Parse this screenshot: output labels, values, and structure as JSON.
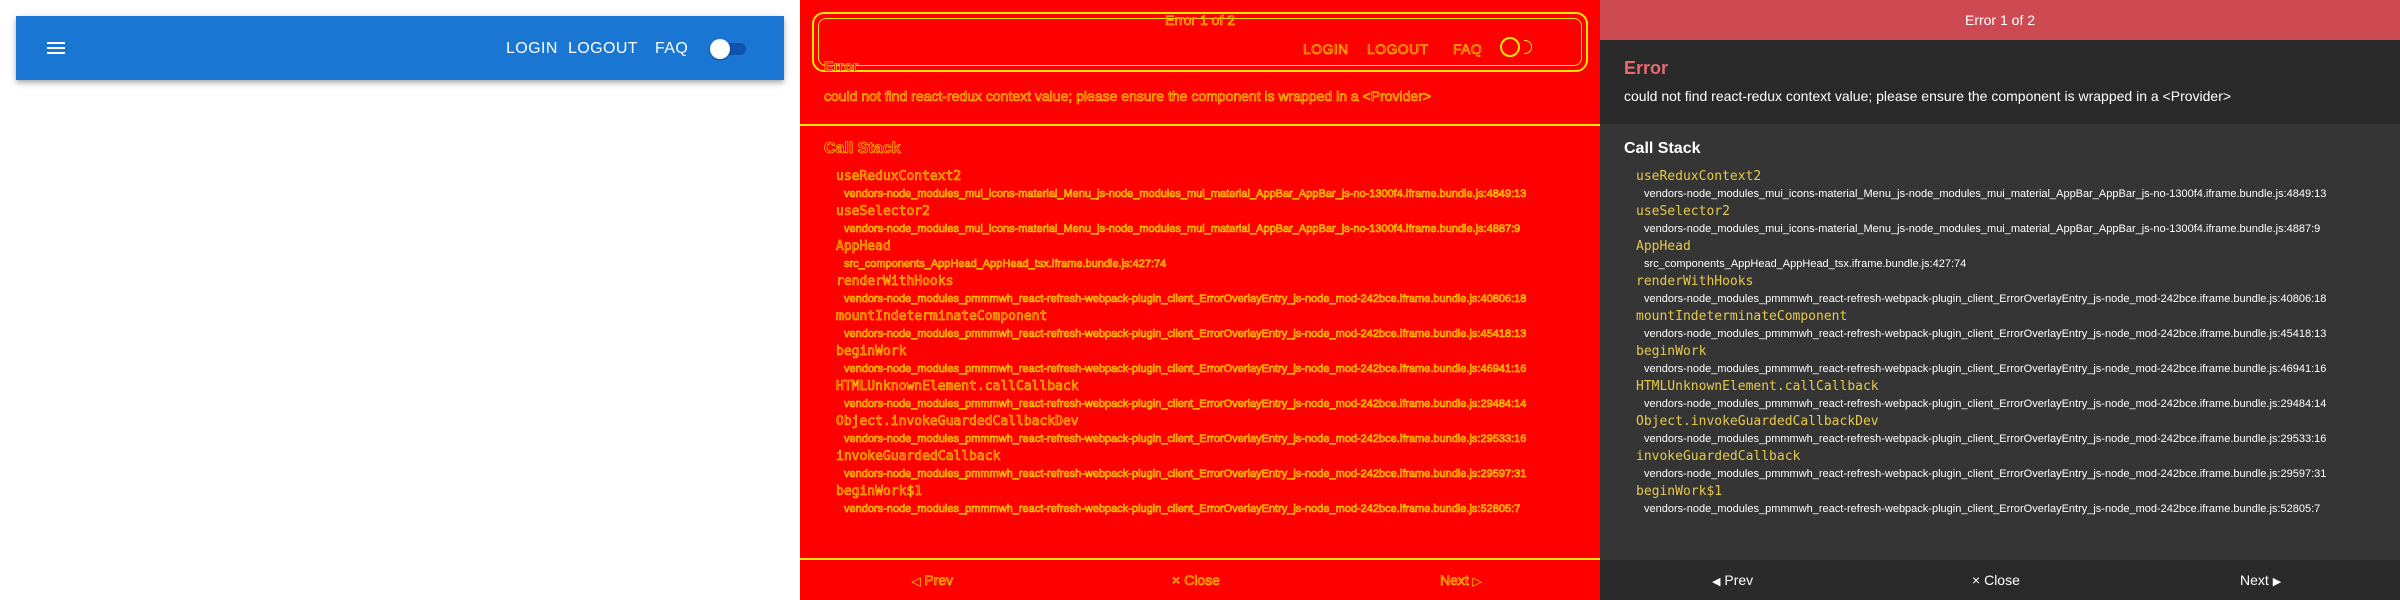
{
  "app": {
    "nav": {
      "login": "LOGIN",
      "logout": "LOGOUT",
      "faq": "FAQ"
    },
    "theme_toggle_checked": true,
    "appbar_color": "#1976d2"
  },
  "overlay": {
    "header": "Error 1 of 2",
    "error_title": "Error",
    "error_message": "could not find react-redux context value; please ensure the component is wrapped in a <Provider>",
    "stack_title": "Call Stack",
    "frames": [
      {
        "fn": "useReduxContext2",
        "src": "vendors-node_modules_mui_icons-material_Menu_js-node_modules_mui_material_AppBar_AppBar_js-no-1300f4.iframe.bundle.js:4849:13"
      },
      {
        "fn": "useSelector2",
        "src": "vendors-node_modules_mui_icons-material_Menu_js-node_modules_mui_material_AppBar_AppBar_js-no-1300f4.iframe.bundle.js:4887:9"
      },
      {
        "fn": "AppHead",
        "src": "src_components_AppHead_AppHead_tsx.iframe.bundle.js:427:74"
      },
      {
        "fn": "renderWithHooks",
        "src": "vendors-node_modules_pmmmwh_react-refresh-webpack-plugin_client_ErrorOverlayEntry_js-node_mod-242bce.iframe.bundle.js:40806:18"
      },
      {
        "fn": "mountIndeterminateComponent",
        "src": "vendors-node_modules_pmmmwh_react-refresh-webpack-plugin_client_ErrorOverlayEntry_js-node_mod-242bce.iframe.bundle.js:45418:13"
      },
      {
        "fn": "beginWork",
        "src": "vendors-node_modules_pmmmwh_react-refresh-webpack-plugin_client_ErrorOverlayEntry_js-node_mod-242bce.iframe.bundle.js:46941:16"
      },
      {
        "fn": "HTMLUnknownElement.callCallback",
        "src": "vendors-node_modules_pmmmwh_react-refresh-webpack-plugin_client_ErrorOverlayEntry_js-node_mod-242bce.iframe.bundle.js:29484:14"
      },
      {
        "fn": "Object.invokeGuardedCallbackDev",
        "src": "vendors-node_modules_pmmmwh_react-refresh-webpack-plugin_client_ErrorOverlayEntry_js-node_mod-242bce.iframe.bundle.js:29533:16"
      },
      {
        "fn": "invokeGuardedCallback",
        "src": "vendors-node_modules_pmmmwh_react-refresh-webpack-plugin_client_ErrorOverlayEntry_js-node_mod-242bce.iframe.bundle.js:29597:31"
      },
      {
        "fn": "beginWork$1",
        "src": "vendors-node_modules_pmmmwh_react-refresh-webpack-plugin_client_ErrorOverlayEntry_js-node_mod-242bce.iframe.bundle.js:52805:7"
      }
    ],
    "footer": {
      "prev": "Prev",
      "close": "Close",
      "next": "Next"
    },
    "colors": {
      "header_bg": "#ce4a52",
      "title": "#e86b74",
      "fn": "#e6c84a",
      "bg": "#353535"
    }
  },
  "edge_panel": {
    "colors": {
      "background": "#ff0000",
      "edges": "#ffe600"
    }
  }
}
